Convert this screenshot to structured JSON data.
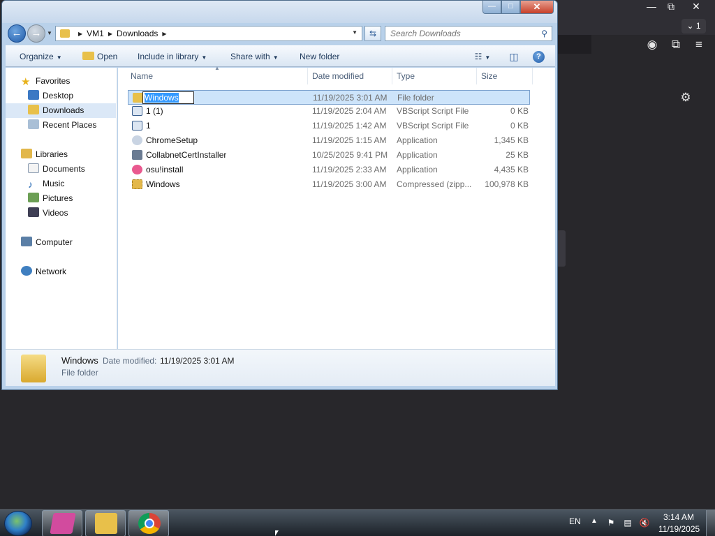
{
  "background_app": {
    "window_controls": {
      "minimize": "—",
      "maximize": "⧉",
      "close": "✕"
    },
    "profiles_label": "1",
    "profiles_icon": "chevron-down-icon",
    "icons": [
      "account-icon",
      "extensions-icon",
      "menu-icon",
      "gear-icon"
    ]
  },
  "window": {
    "controls": {
      "minimize": "—",
      "maximize": "□",
      "close": "✕"
    },
    "breadcrumb": [
      "VM1",
      "Downloads"
    ],
    "search_placeholder": "Search Downloads"
  },
  "toolbar": {
    "organize": "Organize",
    "open": "Open",
    "include_in_library": "Include in library",
    "share_with": "Share with",
    "new_folder": "New folder"
  },
  "navpane": {
    "favorites": "Favorites",
    "desktop": "Desktop",
    "downloads": "Downloads",
    "recent_places": "Recent Places",
    "libraries": "Libraries",
    "documents": "Documents",
    "music": "Music",
    "pictures": "Pictures",
    "videos": "Videos",
    "computer": "Computer",
    "network": "Network"
  },
  "filelist": {
    "columns": {
      "name": "Name",
      "date": "Date modified",
      "type": "Type",
      "size": "Size"
    },
    "rows": [
      {
        "name": "Windows",
        "date": "11/19/2025 3:01 AM",
        "type": "File folder",
        "size": "",
        "icon": "folder-icon"
      },
      {
        "name": "1 (1)",
        "date": "11/19/2025 2:04 AM",
        "type": "VBScript Script File",
        "size": "0 KB",
        "icon": "vbscript-file-icon"
      },
      {
        "name": "1",
        "date": "11/19/2025 1:42 AM",
        "type": "VBScript Script File",
        "size": "0 KB",
        "icon": "vbscript-file-icon"
      },
      {
        "name": "ChromeSetup",
        "date": "11/19/2025 1:15 AM",
        "type": "Application",
        "size": "1,345 KB",
        "icon": "chrome-setup-icon"
      },
      {
        "name": "CollabnetCertInstaller",
        "date": "10/25/2025 9:41 PM",
        "type": "Application",
        "size": "25 KB",
        "icon": "cert-installer-icon"
      },
      {
        "name": "osu!install",
        "date": "11/19/2025 2:33 AM",
        "type": "Application",
        "size": "4,435 KB",
        "icon": "osu-icon"
      },
      {
        "name": "Windows",
        "date": "11/19/2025 3:00 AM",
        "type": "Compressed (zipp...",
        "size": "100,978 KB",
        "icon": "zip-folder-icon"
      }
    ],
    "rename_value": "Windows"
  },
  "details": {
    "name": "Windows",
    "date_label": "Date modified:",
    "date_value": "11/19/2025 3:01 AM",
    "type": "File folder"
  },
  "taskbar": {
    "language": "EN",
    "time": "3:14 AM",
    "date": "11/19/2025"
  }
}
